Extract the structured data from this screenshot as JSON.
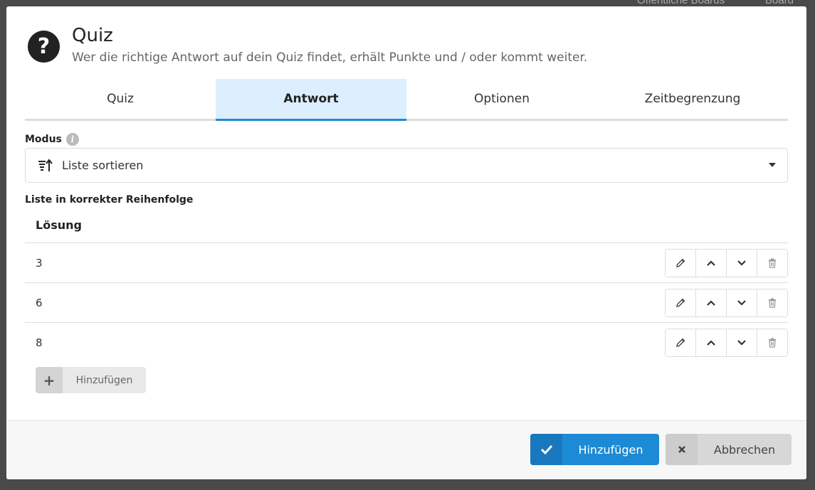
{
  "background": {
    "top_links": [
      "Öffentliche Boards",
      "Board erstellen"
    ]
  },
  "modal": {
    "title": "Quiz",
    "subtitle": "Wer die richtige Antwort auf dein Quiz findet, erhält Punkte und / oder kommt weiter.",
    "tabs": [
      {
        "label": "Quiz",
        "active": false
      },
      {
        "label": "Antwort",
        "active": true
      },
      {
        "label": "Optionen",
        "active": false
      },
      {
        "label": "Zeitbegrenzung",
        "active": false
      }
    ],
    "mode": {
      "label": "Modus",
      "selected": "Liste sortieren"
    },
    "list": {
      "label": "Liste in korrekter Reihenfolge",
      "column_header": "Lösung",
      "rows": [
        "3",
        "6",
        "8"
      ],
      "add_label": "Hinzufügen"
    },
    "footer": {
      "submit_label": "Hinzufügen",
      "cancel_label": "Abbrechen"
    }
  },
  "colors": {
    "accent": "#1d8ad6",
    "active_tab_bg": "#ddeeff"
  }
}
